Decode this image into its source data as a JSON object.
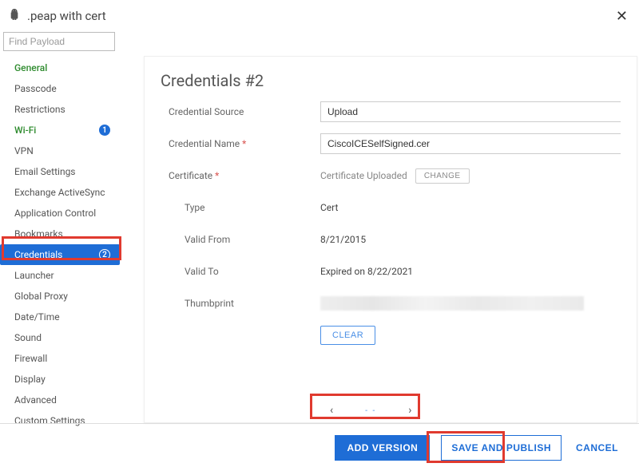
{
  "header": {
    "title": ".peap with cert"
  },
  "search": {
    "placeholder": "Find Payload"
  },
  "sidebar": {
    "items": [
      {
        "label": "General",
        "style": "green",
        "badge": null
      },
      {
        "label": "Passcode",
        "style": "",
        "badge": null
      },
      {
        "label": "Restrictions",
        "style": "",
        "badge": null
      },
      {
        "label": "Wi-Fi",
        "style": "green",
        "badge": "1"
      },
      {
        "label": "VPN",
        "style": "",
        "badge": null
      },
      {
        "label": "Email Settings",
        "style": "",
        "badge": null
      },
      {
        "label": "Exchange ActiveSync",
        "style": "",
        "badge": null
      },
      {
        "label": "Application Control",
        "style": "",
        "badge": null
      },
      {
        "label": "Bookmarks",
        "style": "",
        "badge": null
      },
      {
        "label": "Credentials",
        "style": "active",
        "badge": "2"
      },
      {
        "label": "Launcher",
        "style": "",
        "badge": null
      },
      {
        "label": "Global Proxy",
        "style": "",
        "badge": null
      },
      {
        "label": "Date/Time",
        "style": "",
        "badge": null
      },
      {
        "label": "Sound",
        "style": "",
        "badge": null
      },
      {
        "label": "Firewall",
        "style": "",
        "badge": null
      },
      {
        "label": "Display",
        "style": "",
        "badge": null
      },
      {
        "label": "Advanced",
        "style": "",
        "badge": null
      },
      {
        "label": "Custom Settings",
        "style": "",
        "badge": null
      }
    ]
  },
  "panel": {
    "heading": "Credentials #2",
    "labels": {
      "credential_source": "Credential Source",
      "credential_name": "Credential Name",
      "certificate": "Certificate",
      "type": "Type",
      "valid_from": "Valid From",
      "valid_to": "Valid To",
      "thumbprint": "Thumbprint"
    },
    "values": {
      "credential_source": "Upload",
      "credential_name": "CiscoICESelfSigned.cer",
      "certificate_status": "Certificate Uploaded",
      "change_btn": "CHANGE",
      "type": "Cert",
      "valid_from": "8/21/2015",
      "valid_to": "Expired on 8/22/2021",
      "clear_btn": "CLEAR"
    }
  },
  "footer": {
    "add_version": "ADD VERSION",
    "save_publish": "SAVE AND PUBLISH",
    "cancel": "CANCEL"
  }
}
